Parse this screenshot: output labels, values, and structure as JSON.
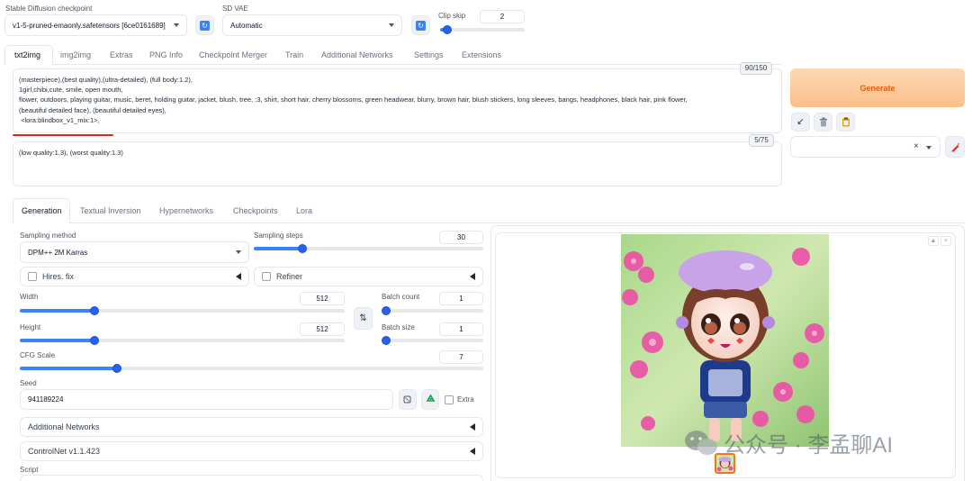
{
  "checkpoint": {
    "label": "Stable Diffusion checkpoint",
    "value": "v1-5-pruned-emaonly.safetensors [6ce0161689]"
  },
  "vae": {
    "label": "SD VAE",
    "value": "Automatic"
  },
  "clip_skip": {
    "label": "Clip skip",
    "value": "2",
    "fraction": 0.09
  },
  "main_tabs": [
    "txt2img",
    "img2img",
    "Extras",
    "PNG Info",
    "Checkpoint Merger",
    "Train",
    "Additional Networks",
    "Settings",
    "Extensions"
  ],
  "prompt": {
    "counter": "90/150",
    "text": "(masterpiece),(best quality),(ultra-detailed), (full body:1.2),\n1girl,chibi,cute, smile, open mouth,\nflower, outdoors, playing guitar, music, beret, holding guitar, jacket, blush, tree, :3, shirt, short hair, cherry blossoms, green headwear, blurry, brown hair, blush stickers, long sleeves, bangs, headphones, black hair, pink flower,\n(beautiful detailed face), (beautiful detailed eyes),\n <lora:blindbox_v1_mix:1>,"
  },
  "negative": {
    "counter": "5/75",
    "text": "(low quality:1.3), (worst quality:1.3)"
  },
  "generate_label": "Generate",
  "sub_tabs": [
    "Generation",
    "Textual Inversion",
    "Hypernetworks",
    "Checkpoints",
    "Lora"
  ],
  "sampling_method": {
    "label": "Sampling method",
    "value": "DPM++ 2M Karras"
  },
  "sampling_steps": {
    "label": "Sampling steps",
    "value": "30",
    "fraction": 0.21
  },
  "hires_label": "Hires. fix",
  "refiner_label": "Refiner",
  "width": {
    "label": "Width",
    "value": "512",
    "fraction": 0.23
  },
  "height": {
    "label": "Height",
    "value": "512",
    "fraction": 0.23
  },
  "batch_count": {
    "label": "Batch count",
    "value": "1",
    "fraction": 0.0
  },
  "batch_size": {
    "label": "Batch size",
    "value": "1",
    "fraction": 0.0
  },
  "cfg_scale": {
    "label": "CFG Scale",
    "value": "7",
    "fraction": 0.21
  },
  "seed": {
    "label": "Seed",
    "value": "941189224",
    "extra_label": "Extra"
  },
  "additional_networks_label": "Additional Networks",
  "controlnet_label": "ControlNet v1.1.423",
  "script_label": "Script",
  "watermark": "公众号 · 李孟聊AI"
}
